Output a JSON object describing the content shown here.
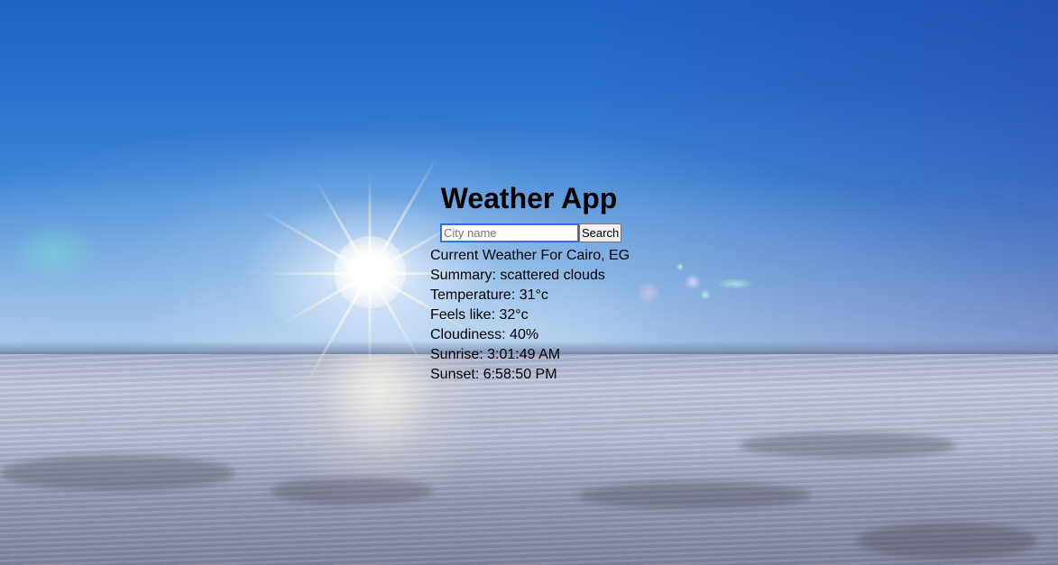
{
  "app": {
    "title": "Weather App"
  },
  "search": {
    "placeholder": "City name",
    "value": "",
    "button_label": "Search"
  },
  "weather": {
    "heading": "Current Weather For Cairo, EG",
    "summary": "Summary: scattered clouds",
    "temperature": "Temperature: 31°c",
    "feels_like": "Feels like: 32°c",
    "cloudiness": "Cloudiness: 40%",
    "sunrise": "Sunrise: 3:01:49 AM",
    "sunset": "Sunset: 6:58:50 PM"
  },
  "colors": {
    "sky_top": "#1f63c4",
    "sky_horizon": "#bcd3ec",
    "snow": "#b4bad2",
    "text": "#000000"
  }
}
